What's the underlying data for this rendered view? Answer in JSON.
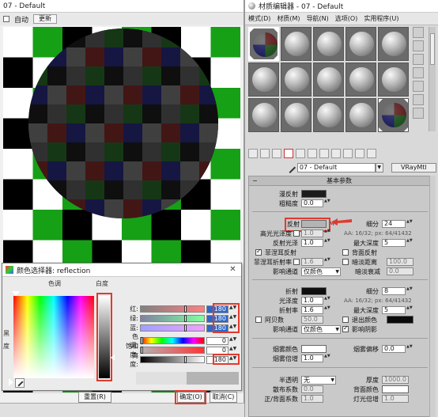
{
  "render_window": {
    "title": "07 - Default",
    "toolbar": {
      "auto_label": "自动",
      "update_label": "更新"
    }
  },
  "color_dialog": {
    "title": "颜色选择器: reflection",
    "hue_header": "色调",
    "whiteness_header": "白度",
    "side_labels": [
      "黑",
      "度"
    ],
    "rows": [
      {
        "label": "红:",
        "value": "180",
        "highlight": true,
        "thumb": 0.7,
        "gradient": "linear-gradient(to right,#808080,#ff8080)"
      },
      {
        "label": "绿:",
        "value": "180",
        "highlight": true,
        "thumb": 0.7,
        "gradient": "linear-gradient(to right,#8080a0,#80ffa0)"
      },
      {
        "label": "蓝:",
        "value": "180",
        "highlight": true,
        "thumb": 0.7,
        "gradient": "linear-gradient(to right,#a0a0ff,#f0a0ff)"
      },
      {
        "label": "色调:",
        "value": "0",
        "highlight": false,
        "thumb": 0.0,
        "gradient": "linear-gradient(to right,#f00,#ff0,#0f0,#0ff,#00f,#f0f,#f00)"
      },
      {
        "label": "饱和度:",
        "value": "0",
        "highlight": false,
        "thumb": 0.0,
        "gradient": "linear-gradient(to right,#b4b4b4,#f33)"
      },
      {
        "label": "亮度:",
        "value": "180",
        "highlight": false,
        "thumb": 0.7,
        "gradient": "linear-gradient(to right,#000,#fff)"
      }
    ],
    "reset_label": "重置(R)",
    "ok_label": "确定(O)",
    "cancel_label": "取消(C)"
  },
  "material_editor": {
    "title": "材质编辑器 - 07 - Default",
    "menu": [
      "模式(D)",
      "材质(M)",
      "导航(N)",
      "选项(O)",
      "实用程序(U)"
    ],
    "material_name": "07 - Default",
    "material_type": "VRayMtl",
    "rollout_title": "基本参数",
    "diffuse": {
      "label": "漫反射",
      "roughness_label": "粗糙度",
      "roughness": "0.0"
    },
    "reflection": {
      "label": "反射",
      "m_label": "M",
      "subdivs_label": "细分",
      "subdivs": "24",
      "hilight_label": "高光光泽度",
      "hilight": "1.0",
      "aa_info": "AA: 16/32; px: 64/41432",
      "gloss_label": "反射光泽",
      "gloss": "1.0",
      "max_depth_label": "最大深度",
      "max_depth": "5",
      "fresnel_label": "菲涅耳反射",
      "fresnel_checked": true,
      "back_label": "背面反射",
      "fresnel_ior_label": "菲涅耳折射率",
      "fresnel_ior": "1.6",
      "dim_label": "暗淡距离",
      "dim_value": "100.0",
      "exit_label": "影响通道",
      "exit_value": "仅颜色",
      "dim_falloff_label": "暗淡衰减",
      "dim_falloff": "0.0"
    },
    "refraction": {
      "label": "折射",
      "subdivs_label": "细分",
      "subdivs": "8",
      "gloss_label": "光泽度",
      "gloss": "1.0",
      "aa_info": "AA: 16/32; px: 64/41432",
      "ior_label": "折射率",
      "ior": "1.6",
      "max_depth_label": "最大深度",
      "max_depth": "5",
      "abbe_label": "阿贝数",
      "abbe": "50.0",
      "exit_color_label": "退出颜色",
      "affect_label": "影响通道",
      "affect_value": "仅颜色",
      "shadows_label": "影响阴影",
      "shadows_checked": true
    },
    "fog": {
      "color_label": "烟雾颜色",
      "bias_label": "烟雾偏移",
      "bias": "0.0",
      "mult_label": "烟雾倍增",
      "mult": "1.0"
    },
    "translucency": {
      "label": "半透明",
      "value": "无",
      "thickness_label": "厚度",
      "thickness": "1000.0",
      "scatter_label": "散布系数",
      "scatter": "0.0",
      "back_color_label": "背面颜色",
      "fwd_label": "正/背面系数",
      "fwd": "1.0",
      "light_label": "灯光倍增",
      "light": "1.0"
    }
  },
  "colors": {
    "annotation_red": "#e03a2f",
    "value_highlight": "#2f67c8",
    "reflection_swatch": "#b4b4b4"
  }
}
